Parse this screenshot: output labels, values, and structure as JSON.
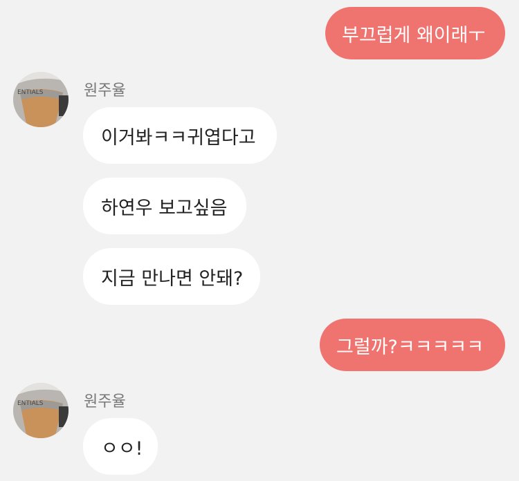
{
  "conversation": {
    "messages": [
      {
        "direction": "outgoing",
        "text": "부끄럽게 왜이래ㅜ"
      },
      {
        "direction": "incoming",
        "sender": "원주율",
        "avatar_text": "ENTIALS",
        "text": "이거봐ㅋㅋ귀엽다고"
      },
      {
        "direction": "incoming",
        "text": "하연우 보고싶음"
      },
      {
        "direction": "incoming",
        "text": "지금 만나면 안돼?"
      },
      {
        "direction": "outgoing",
        "text": "그럴까?ㅋㅋㅋㅋㅋ"
      },
      {
        "direction": "incoming",
        "sender": "원주율",
        "avatar_text": "ENTIALS",
        "text": "ㅇㅇ!"
      }
    ]
  },
  "colors": {
    "outgoing_bubble": "#ef7470",
    "incoming_bubble": "#ffffff",
    "background": "#f2f2f2"
  }
}
